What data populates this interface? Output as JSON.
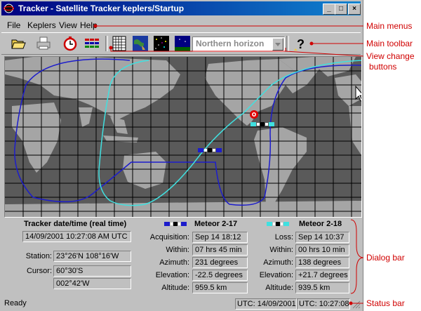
{
  "window": {
    "title": "Tracker - Satellite Tracker  keplers/Startup",
    "min_icon": "minimize-icon",
    "max_icon": "maximize-icon",
    "close_icon": "close-icon"
  },
  "menu": [
    "File",
    "Keplers",
    "View",
    "Help"
  ],
  "toolbar": {
    "icons": [
      "open-folder-icon",
      "print-icon",
      "clock-icon",
      "satellite-list-icon",
      "data-table-icon",
      "world-map-icon",
      "star-field-icon",
      "sky-view-icon",
      "help-icon"
    ],
    "view_select": "Northern horizon"
  },
  "dialog": {
    "tracker_title": "Tracker date/time (real time)",
    "datetime": "14/09/2001 10:27:08 AM UTC",
    "station_label": "Station:",
    "station_value": "23°26'N  108°16'W",
    "cursor_label": "Cursor:",
    "cursor_lat": "60°30'S",
    "cursor_lon": "002°42'W",
    "sat1": {
      "name": "Meteor 2-17",
      "labels": [
        "Acquisition:",
        "Within:",
        "Azimuth:",
        "Elevation:",
        "Altitude:"
      ],
      "values": [
        "Sep 14  18:12",
        "07 hrs 45 min",
        "231 degrees",
        "-22.5 degrees",
        "959.5 km"
      ]
    },
    "sat2": {
      "name": "Meteor 2-18",
      "labels": [
        "Loss:",
        "Within:",
        "Azimuth:",
        "Elevation:",
        "Altitude:"
      ],
      "values": [
        "Sep 14  10:37",
        "00 hrs 10 min",
        "138 degrees",
        "+21.7 degrees",
        "939.5 km"
      ]
    }
  },
  "status": {
    "ready": "Ready",
    "date": "UTC: 14/09/2001",
    "time": "UTC: 10:27:08"
  },
  "annotations": {
    "main_menus": "Main menus",
    "main_toolbar": "Main toolbar",
    "view_change_1": "View change",
    "view_change_2": "buttons",
    "dialog_bar": "Dialog bar",
    "status_bar": "Status bar"
  },
  "colors": {
    "title_gradient_start": "#000080",
    "title_gradient_end": "#1084d0",
    "annotation_red": "#d00000",
    "track_blue": "#1c1ccc",
    "track_cyan": "#40e0e0",
    "map_ocean": "#5a5a5a",
    "map_land": "#a5a5a5"
  }
}
